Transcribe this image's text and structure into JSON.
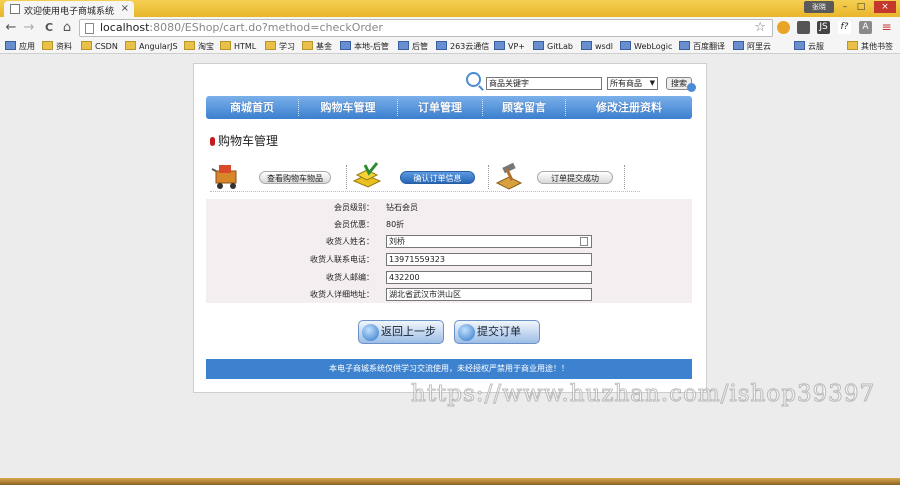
{
  "browser": {
    "tab_title": "欢迎使用电子商城系统",
    "tab_close": "×",
    "user_badge": "张晓",
    "win_min": "–",
    "win_max": "□",
    "win_close": "×",
    "nav": {
      "back": "←",
      "forward": "→",
      "reload": "C",
      "home": "⌂"
    },
    "url_host": "localhost",
    "url_rest": ":8080/EShop/cart.do?method=checkOrder",
    "star": "☆",
    "extensions": [
      "JS",
      "f?",
      "A",
      "≡"
    ],
    "bookmarks": [
      "应用",
      "资料",
      "CSDN",
      "AngularJS",
      "淘宝",
      "HTML",
      "学习",
      "基金",
      "本地-后管",
      "后管",
      "263云通信",
      "VP+",
      "GitLab",
      "wsdl",
      "WebLogic",
      "百度翻译",
      "阿里云",
      "云服",
      "其他书签"
    ]
  },
  "search": {
    "placeholder": "商品关键字",
    "category": "所有商品",
    "category_arrow": "▼",
    "button": "搜索"
  },
  "menu": [
    "商城首页",
    "购物车管理",
    "订单管理",
    "顾客留言",
    "修改注册资料"
  ],
  "section_title": "购物车管理",
  "steps": [
    {
      "label": "查看购物车物品",
      "active": false
    },
    {
      "label": "确认订单信息",
      "active": true
    },
    {
      "label": "订单提交成功",
      "active": false
    }
  ],
  "form": {
    "member_level_label": "会员级别：",
    "member_level": "钻石会员",
    "member_discount_label": "会员优惠：",
    "member_discount": "80折",
    "name_label": "收货人姓名：",
    "name": "刘桥",
    "phone_label": "收货人联系电话：",
    "phone": "13971559323",
    "zip_label": "收货人邮编：",
    "zip": "432200",
    "address_label": "收货人详细地址：",
    "address": "湖北省武汉市洪山区"
  },
  "buttons": {
    "back": "返回上一步",
    "submit": "提交订单"
  },
  "footer": "本电子商城系统仅供学习交流使用，未经授权严禁用于商业用途！！",
  "watermark": "https://www.huzhan.com/ishop39397",
  "colors": {
    "menu_blue": "#3b7fcf",
    "footer_blue": "#3d82cf",
    "titlebar_yellow": "#f1c232"
  }
}
